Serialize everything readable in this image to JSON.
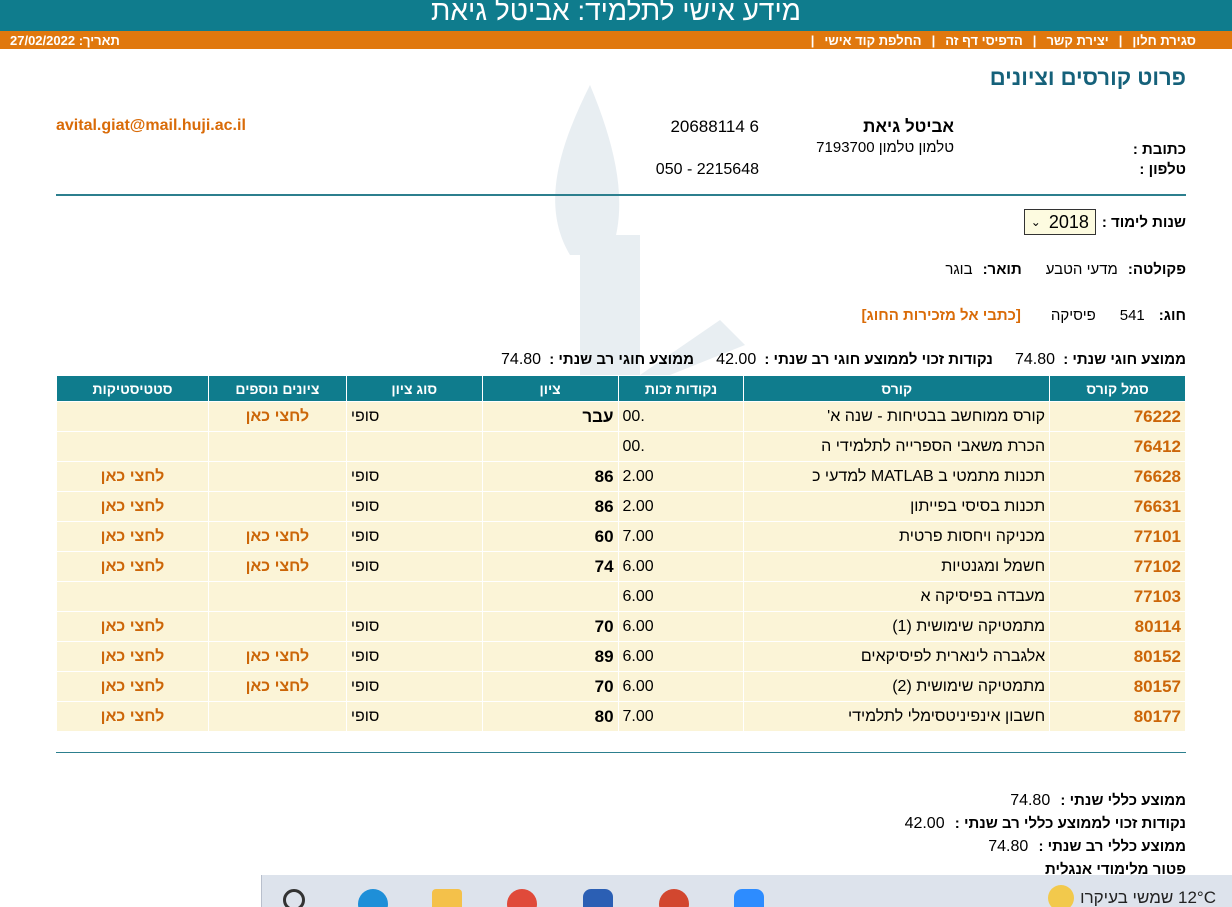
{
  "window_title": "מידע אישי לתלמיד: אביטל גיאת",
  "menu": {
    "items": [
      "סגירת חלון",
      "יצירת קשר",
      "הדפיסי  דף זה",
      "החלפת קוד אישי"
    ],
    "separator": "|",
    "date": "תאריך: 27/02/2022"
  },
  "page_heading": "פרוט קורסים וציונים",
  "student": {
    "name": "אביטל גיאת",
    "id": "20688114 6",
    "address_label": "כתובת :",
    "address": "טלמון טלמון 7193700",
    "phone_label": "טלפון :",
    "phone": "050 - 2215648",
    "email": "avital.giat@mail.huji.ac.il"
  },
  "year": {
    "label": "שנות לימוד :",
    "value": "2018"
  },
  "faculty": {
    "faculty_label": "פקולטה:",
    "faculty_value": "מדעי הטבע",
    "degree_label": "תואר:",
    "degree_value": "בוגר"
  },
  "program": {
    "label": "חוג:",
    "code": "541",
    "name": "פיסיקה",
    "secretary_link": "[כתבי אל מזכירות החוג]"
  },
  "program_averages": {
    "annual_label": "ממוצע חוגי שנתי :",
    "annual_value": "74.80",
    "credits_label": "נקודות זכוי לממוצע חוגי רב שנתי :",
    "credits_value": "42.00",
    "multi_label": "ממוצע חוגי רב שנתי :",
    "multi_value": "74.80"
  },
  "table": {
    "headers": [
      "סמל קורס",
      "קורס",
      "נקודות זכות",
      "ציון",
      "סוג ציון",
      "ציונים נוספים",
      "סטטיסטיקות"
    ],
    "rows": [
      {
        "code": "76222",
        "course": "קורס ממוחשב בבטיחות - שנה א'",
        "credits": ".00",
        "grade": "עבר",
        "type": "סופי",
        "more": "לחצי כאן",
        "stats": ""
      },
      {
        "code": "76412",
        "course": "הכרת משאבי הספרייה לתלמידי ה",
        "credits": ".00",
        "grade": "",
        "type": "",
        "more": "",
        "stats": ""
      },
      {
        "code": "76628",
        "course": "תכנות מתמטי ב MATLAB למדעי כ",
        "credits": "2.00",
        "grade": "86",
        "type": "סופי",
        "more": "",
        "stats": "לחצי כאן"
      },
      {
        "code": "76631",
        "course": "תכנות בסיסי בפייתון",
        "credits": "2.00",
        "grade": "86",
        "type": "סופי",
        "more": "",
        "stats": "לחצי כאן"
      },
      {
        "code": "77101",
        "course": "מכניקה ויחסות פרטית",
        "credits": "7.00",
        "grade": "60",
        "type": "סופי",
        "more": "לחצי כאן",
        "stats": "לחצי כאן"
      },
      {
        "code": "77102",
        "course": "חשמל ומגנטיות",
        "credits": "6.00",
        "grade": "74",
        "type": "סופי",
        "more": "לחצי כאן",
        "stats": "לחצי כאן"
      },
      {
        "code": "77103",
        "course": "מעבדה בפיסיקה א",
        "credits": "6.00",
        "grade": "",
        "type": "",
        "more": "",
        "stats": ""
      },
      {
        "code": "80114",
        "course": "מתמטיקה שימושית (1)",
        "credits": "6.00",
        "grade": "70",
        "type": "סופי",
        "more": "",
        "stats": "לחצי כאן"
      },
      {
        "code": "80152",
        "course": "אלגברה לינארית לפיסיקאים",
        "credits": "6.00",
        "grade": "89",
        "type": "סופי",
        "more": "לחצי כאן",
        "stats": "לחצי כאן"
      },
      {
        "code": "80157",
        "course": "מתמטיקה שימושית (2)",
        "credits": "6.00",
        "grade": "70",
        "type": "סופי",
        "more": "לחצי כאן",
        "stats": "לחצי כאן"
      },
      {
        "code": "80177",
        "course": "חשבון אינפיניטסימלי לתלמידי",
        "credits": "7.00",
        "grade": "80",
        "type": "סופי",
        "more": "",
        "stats": "לחצי כאן"
      }
    ]
  },
  "summary": {
    "annual_label": "ממוצע כללי שנתי :",
    "annual_value": "74.80",
    "credits_label": "נקודות זכוי לממוצע כללי רב שנתי :",
    "credits_value": "42.00",
    "multi_label": "ממוצע כללי רב שנתי :",
    "multi_value": "74.80",
    "exemption": "פטור מלימודי אנגלית"
  },
  "taskbar": {
    "weather": "12°C  שמשי בעיקרו"
  },
  "colors": {
    "teal": "#0f7c8d",
    "orange_bar": "#e0780e",
    "link_orange": "#cc6608",
    "row_bg": "#fbf4d7"
  }
}
